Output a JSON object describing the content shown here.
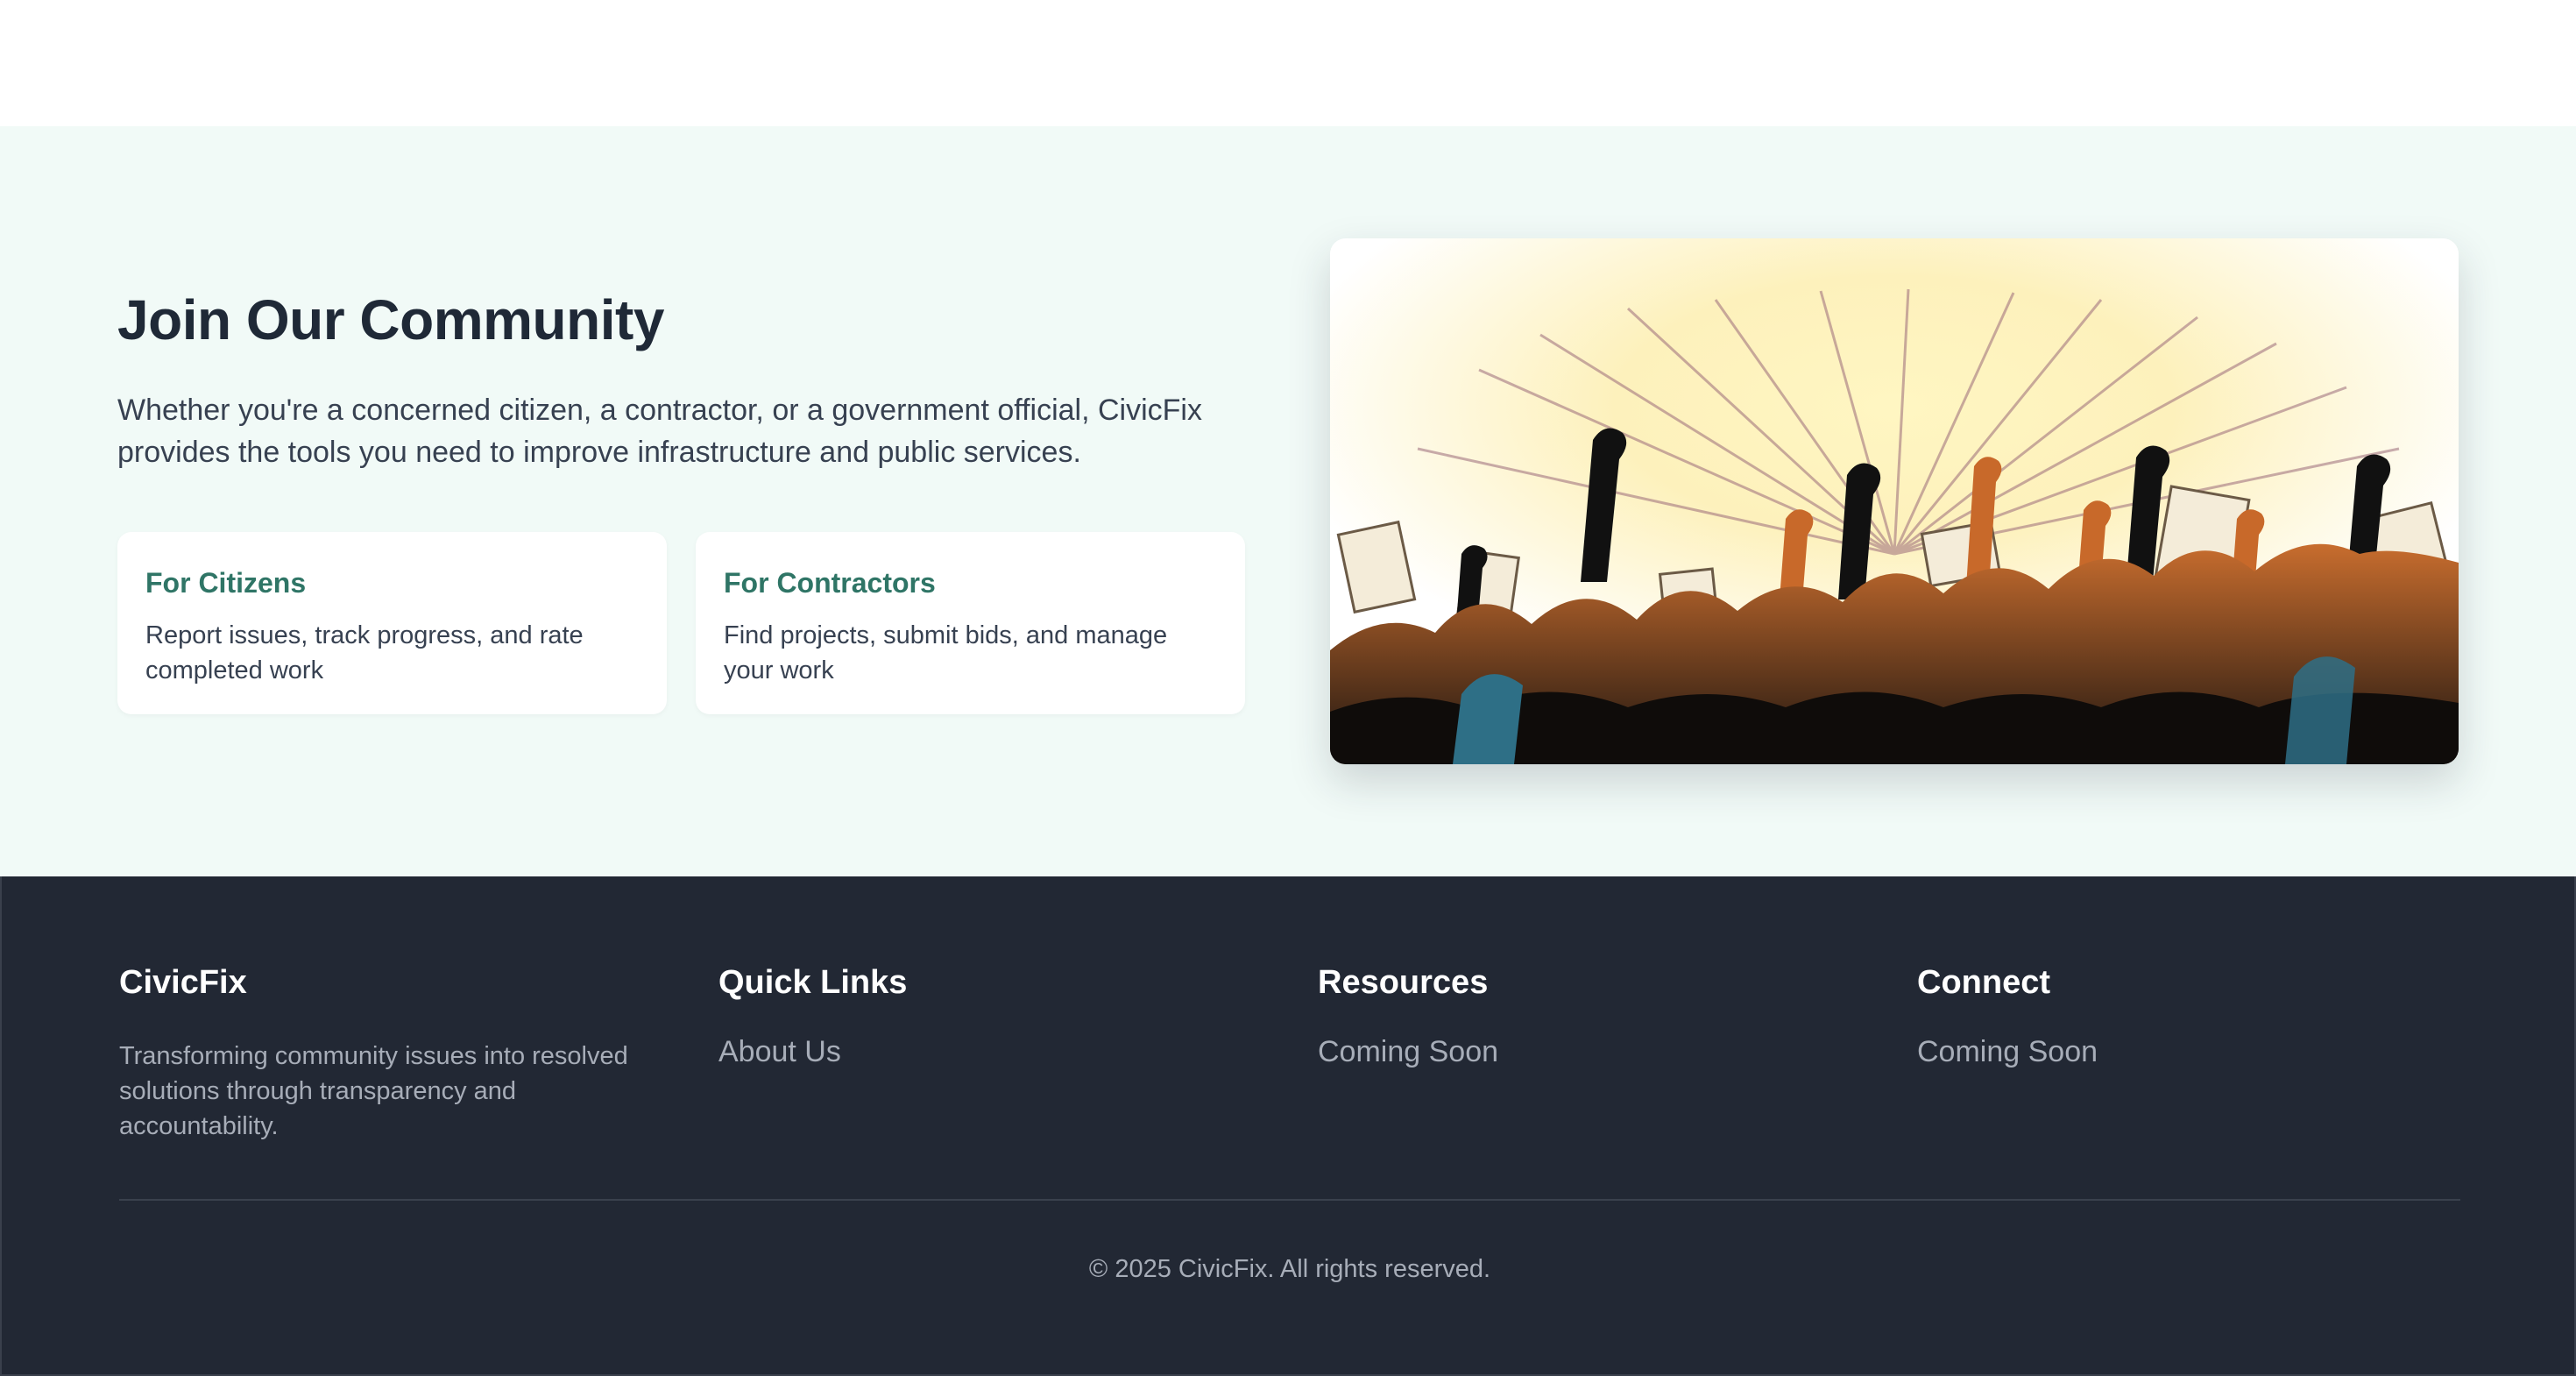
{
  "community": {
    "title": "Join Our Community",
    "description": "Whether you're a concerned citizen, a contractor, or a government official, CivicFix provides the tools you need to improve infrastructure and public services.",
    "cards": [
      {
        "title": "For Citizens",
        "text": "Report issues, track progress, and rate completed work"
      },
      {
        "title": "For Contractors",
        "text": "Find projects, submit bids, and manage your work"
      }
    ],
    "image_icon": "crowd-raised-fists-illustration"
  },
  "footer": {
    "brand": {
      "title": "CivicFix",
      "text": "Transforming community issues into resolved solutions through transparency and accountability."
    },
    "quick_links": {
      "title": "Quick Links",
      "link": "About Us"
    },
    "resources": {
      "title": "Resources",
      "link": "Coming Soon"
    },
    "connect": {
      "title": "Connect",
      "link": "Coming Soon"
    },
    "copyright": "© 2025 CivicFix. All rights reserved."
  },
  "colors": {
    "section_bg": "#f1faf7",
    "card_title": "#2f7566",
    "footer_bg": "#222834",
    "footer_text": "#a7adb8"
  }
}
